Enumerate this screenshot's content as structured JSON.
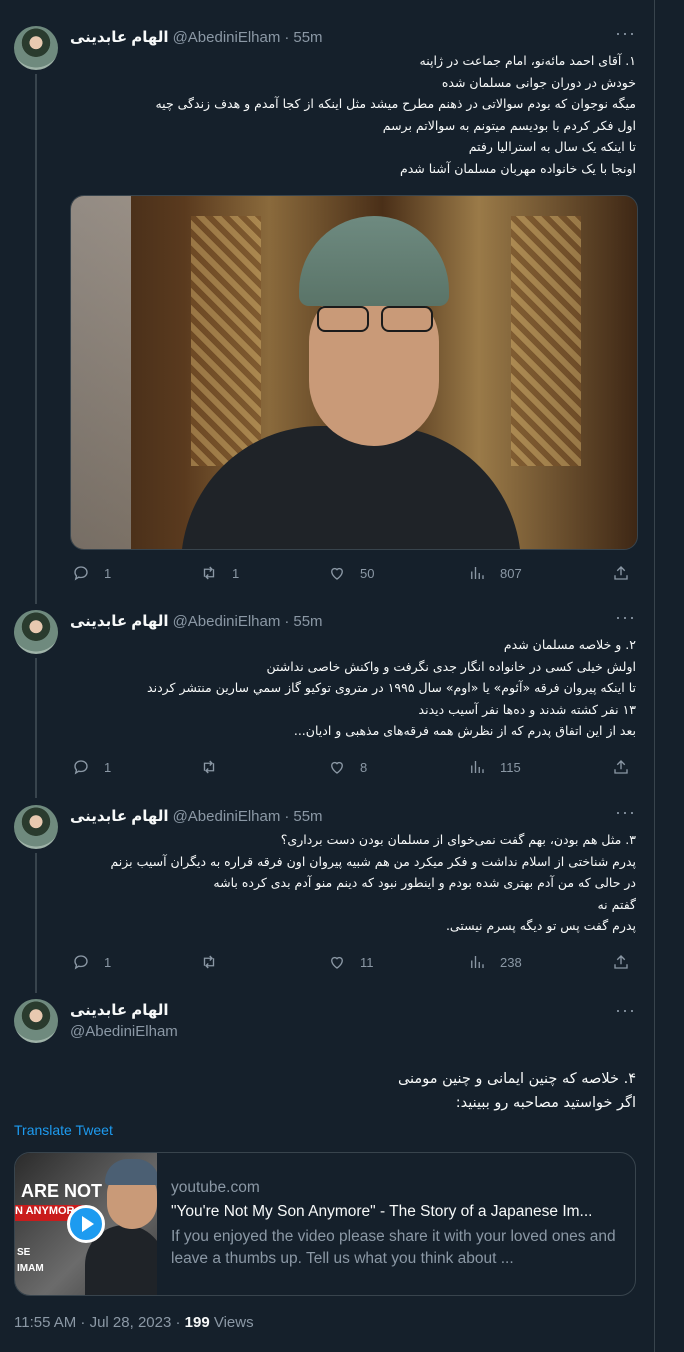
{
  "tweets": [
    {
      "name": "الهام عابدینی",
      "handle": "@AbediniElham",
      "time": "55m",
      "lines": [
        "۱. آقای احمد مائه‌نو، امام جماعت در ژاپنه",
        "خودش در دوران جوانی مسلمان شده",
        "میگه نوجوان که بودم سوالاتی در ذهنم مطرح میشد مثل اینکه از کجا آمدم و هدف زندگی چیه",
        "اول فکر کردم با بودیسم میتونم به سوالاتم برسم",
        "تا اینکه یک سال به استرالیا رفتم",
        "اونجا با یک خانواده مهربان مسلمان آشنا شدم"
      ],
      "replies": "1",
      "retweets": "1",
      "likes": "50",
      "views": "807"
    },
    {
      "name": "الهام عابدینی",
      "handle": "@AbediniElham",
      "time": "55m",
      "lines": [
        "۲. و خلاصه مسلمان شدم",
        "اولش خیلی کسی در خانواده انگار جدی نگرفت و واکنش خاصی نداشتن",
        "تا اینکه پیروان فرقه «آئوم» یا «اوم» سال ۱۹۹۵ در متروی توکیو گاز سمي سارين منتشر کردند",
        "۱۳ نفر کشته شدند و ده‌ها نفر آسیب دیدند",
        "بعد از این اتفاق پدرم که از نظرش همه فرقه‌های مذهبی و ادیان..."
      ],
      "replies": "1",
      "retweets": "",
      "likes": "8",
      "views": "115"
    },
    {
      "name": "الهام عابدینی",
      "handle": "@AbediniElham",
      "time": "55m",
      "lines": [
        "۳. مثل هم بودن، بهم گفت نمی‌خوای از مسلمان بودن دست برداری؟",
        "پدرم شناختی از اسلام نداشت و فکر میکرد من هم شبیه پیروان اون فرقه قراره به دیگران آسیب بزنم",
        "در حالی که من آدم بهتری شده بودم و اینطور نبود که دینم منو آدم بدی کرده باشه",
        "گفتم نه",
        "پدرم گفت پس تو دیگه پسرم نیستی."
      ],
      "replies": "1",
      "retweets": "",
      "likes": "11",
      "views": "238"
    }
  ],
  "main_tweet": {
    "name": "الهام عابدینی",
    "handle": "@AbediniElham",
    "lines": [
      "۴. خلاصه که چنین ایمانی و چنین مومنی",
      "اگر خواستید مصاحبه رو ببینید:"
    ],
    "translate_label": "Translate Tweet",
    "card": {
      "thumb_line1": "ARE NOT",
      "thumb_line2": "N ANYMOR",
      "thumb_line3": "SE",
      "thumb_line4": "IMAM",
      "domain": "youtube.com",
      "title": "\"You're Not My Son Anymore\" - The Story of a Japanese Im...",
      "description": "If you enjoyed the video please share it with your loved ones and leave a thumbs up. Tell us what you think about ..."
    },
    "timestamp": "11:55 AM · Jul 28, 2023 · ",
    "views_count": "199",
    "views_label": " Views"
  },
  "colors": {
    "background": "#15202b",
    "text": "#f7f9f9",
    "secondary": "#8b98a5",
    "accent": "#1d9bf0",
    "border": "#38444d"
  }
}
